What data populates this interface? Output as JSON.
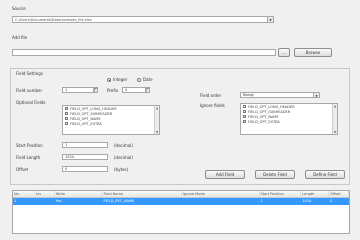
{
  "source": {
    "label": "Source",
    "value": "C:\\Users\\Documents\\Data\\example_file.xlsx"
  },
  "add_file": {
    "label": "Add file",
    "browse_small_label": "...",
    "browse_label": "Browse"
  },
  "field_settings": {
    "label": "Field Settings",
    "mode_integer": "Integer",
    "mode_date": "Date",
    "field_number_label": "Field number",
    "field_number_value": "1",
    "prefix_label": "Prefix",
    "prefix_value": "0",
    "opt_fields_label": "Optional Fields",
    "opt_fields": [
      {
        "label": "FIELD_OPT_LONG_HEADER"
      },
      {
        "label": "FIELD_OPT_SUBHEADER"
      },
      {
        "label": "FIELD_OPT_NAME"
      },
      {
        "label": "FIELD_OPT_EXTRA"
      }
    ],
    "field_order_label": "Field order",
    "field_order_value": "Ready",
    "ignore_fields_label": "Ignore fields",
    "ignore_fields": [
      {
        "label": "FIELD_OPT_LONG_HEADER"
      },
      {
        "label": "FIELD_OPT_SUBHEADER"
      },
      {
        "label": "FIELD_OPT_NAME"
      },
      {
        "label": "FIELD_OPT_EXTRA"
      }
    ],
    "start_position_label": "Start Position",
    "start_position_value": "1",
    "start_position_unit": "(decimal)",
    "field_length_label": "Field Length",
    "field_length_value": "1024",
    "field_length_unit": "(decimal)",
    "offset_label": "Offset",
    "offset_value": "0",
    "offset_unit": "(bytes)"
  },
  "actions": {
    "add_field": "Add Field",
    "delete_field": "Delete Field",
    "define_field": "Define Field"
  },
  "table": {
    "columns": [
      "No.",
      "Ins",
      "Write",
      "Field Name",
      "Ignore Mode",
      "Start Position",
      "Length",
      "Offset"
    ],
    "rows": [
      {
        "no": "1",
        "ins": "",
        "write": "Yes",
        "name": "FIELD_REC_NAME",
        "ignore": "",
        "start": "1",
        "length": "1024",
        "offset": "0"
      }
    ]
  }
}
